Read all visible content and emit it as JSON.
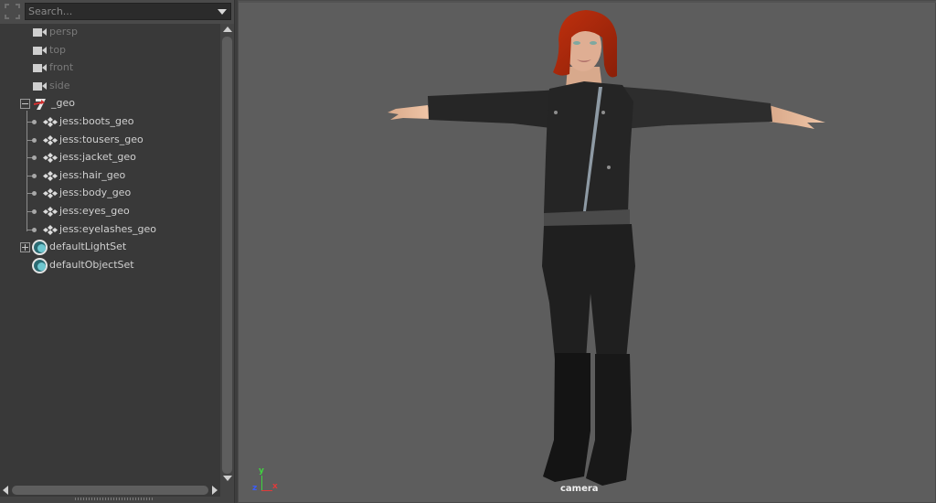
{
  "outliner": {
    "search": {
      "placeholder": "Search...",
      "value": ""
    },
    "items": [
      {
        "label": "persp",
        "type": "camera",
        "dimmed": true
      },
      {
        "label": "top",
        "type": "camera",
        "dimmed": true
      },
      {
        "label": "front",
        "type": "camera",
        "dimmed": true
      },
      {
        "label": "side",
        "type": "camera",
        "dimmed": true
      },
      {
        "label": "_geo",
        "type": "group",
        "expanded": true
      },
      {
        "label": "jess:boots_geo",
        "type": "mesh",
        "parent": "_geo"
      },
      {
        "label": "jess:tousers_geo",
        "type": "mesh",
        "parent": "_geo"
      },
      {
        "label": "jess:jacket_geo",
        "type": "mesh",
        "parent": "_geo"
      },
      {
        "label": "jess:hair_geo",
        "type": "mesh",
        "parent": "_geo"
      },
      {
        "label": "jess:body_geo",
        "type": "mesh",
        "parent": "_geo"
      },
      {
        "label": "jess:eyes_geo",
        "type": "mesh",
        "parent": "_geo"
      },
      {
        "label": "jess:eyelashes_geo",
        "type": "mesh",
        "parent": "_geo"
      },
      {
        "label": "defaultLightSet",
        "type": "set",
        "expanded": false
      },
      {
        "label": "defaultObjectSet",
        "type": "set"
      }
    ]
  },
  "viewport": {
    "camera_name": "camera",
    "axis": {
      "x": "x",
      "y": "y",
      "z": "z"
    },
    "background_color": "#5d5d5d",
    "subject": "female character model in T-pose: red hair, black jacket, black trousers, black boots"
  }
}
